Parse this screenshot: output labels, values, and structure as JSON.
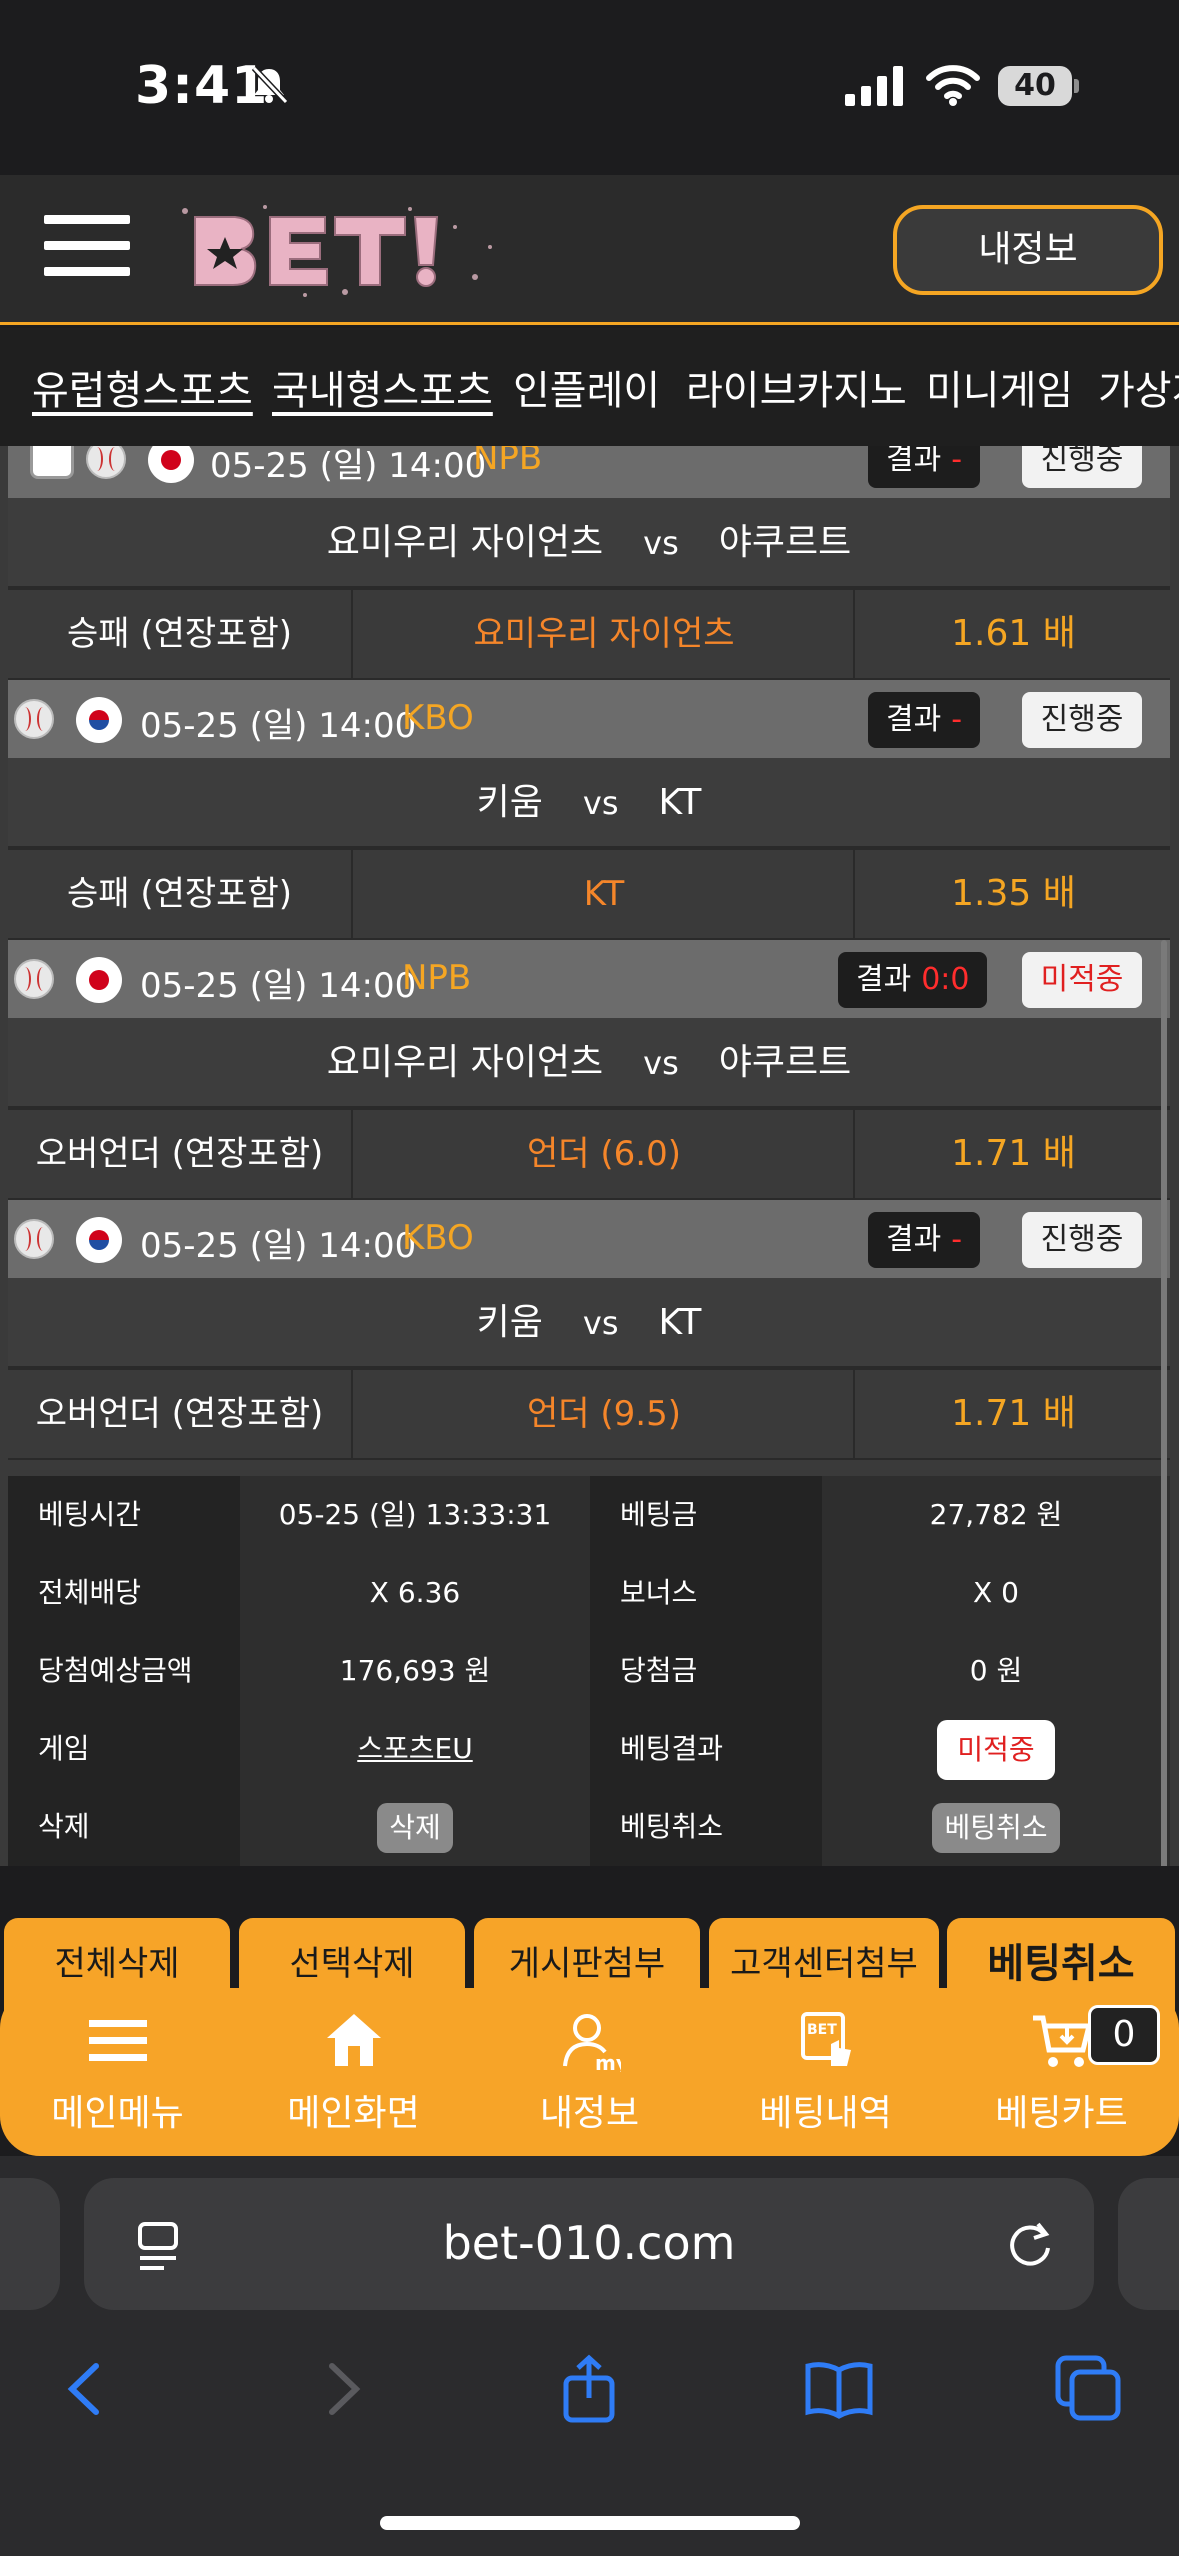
{
  "status": {
    "time": "3:41",
    "battery": "40"
  },
  "header": {
    "myinfo_label": "내정보"
  },
  "categories": [
    "유럽형스포츠",
    "국내형스포츠",
    "인플레이",
    "라이브카지노",
    "미니게임",
    "가상게"
  ],
  "games": [
    {
      "date": "05-25 (일) 14:00",
      "league": "NPB",
      "flag": "jp",
      "result_label": "결과",
      "score": "-",
      "state": "진행중",
      "home": "요미우리 자이언츠",
      "vs": "vs",
      "away": "야쿠르트",
      "market": "승패 (연장포함)",
      "pick": "요미우리 자이언츠",
      "odds": "1.61 배"
    },
    {
      "date": "05-25 (일) 14:00",
      "league": "KBO",
      "flag": "kr",
      "result_label": "결과",
      "score": "-",
      "state": "진행중",
      "home": "키움",
      "vs": "vs",
      "away": "KT",
      "market": "승패 (연장포함)",
      "pick": "KT",
      "odds": "1.35 배"
    },
    {
      "date": "05-25 (일) 14:00",
      "league": "NPB",
      "flag": "jp",
      "result_label": "결과",
      "score": "0:0",
      "state": "미적중",
      "home": "요미우리 자이언츠",
      "vs": "vs",
      "away": "야쿠르트",
      "market": "오버언더 (연장포함)",
      "pick": "언더 (6.0)",
      "odds": "1.71 배"
    },
    {
      "date": "05-25 (일) 14:00",
      "league": "KBO",
      "flag": "kr",
      "result_label": "결과",
      "score": "-",
      "state": "진행중",
      "home": "키움",
      "vs": "vs",
      "away": "KT",
      "market": "오버언더 (연장포함)",
      "pick": "언더 (9.5)",
      "odds": "1.71 배"
    }
  ],
  "summary": {
    "bet_time_label": "베팅시간",
    "bet_time": "05-25 (일) 13:33:31",
    "bet_amount_label": "베팅금",
    "bet_amount": "27,782 원",
    "total_odds_label": "전체배당",
    "total_odds": "X 6.36",
    "bonus_label": "보너스",
    "bonus": "X 0",
    "expected_label": "당첨예상금액",
    "expected": "176,693 원",
    "win_label": "당첨금",
    "win": "0 원",
    "game_label": "게임",
    "game": "스포츠EU",
    "result_label": "베팅결과",
    "result": "미적중",
    "delete_label": "삭제",
    "delete_btn": "삭제",
    "cancel_label": "베팅취소",
    "cancel_btn": "베팅취소"
  },
  "actions": [
    "전체삭제",
    "선택삭제",
    "게시판첨부",
    "고객센터첨부",
    "베팅취소"
  ],
  "bottom_menu": [
    {
      "label": "메인메뉴",
      "icon": "menu-icon"
    },
    {
      "label": "메인화면",
      "icon": "home-icon"
    },
    {
      "label": "내정보",
      "icon": "user-icon"
    },
    {
      "label": "베팅내역",
      "icon": "bet-history-icon"
    },
    {
      "label": "베팅카트",
      "icon": "cart-icon"
    }
  ],
  "cart_count": "0",
  "browser": {
    "url": "bet-010.com"
  },
  "colors": {
    "accent": "#f5a623",
    "pick": "#f5862a",
    "loss": "#e02020"
  }
}
